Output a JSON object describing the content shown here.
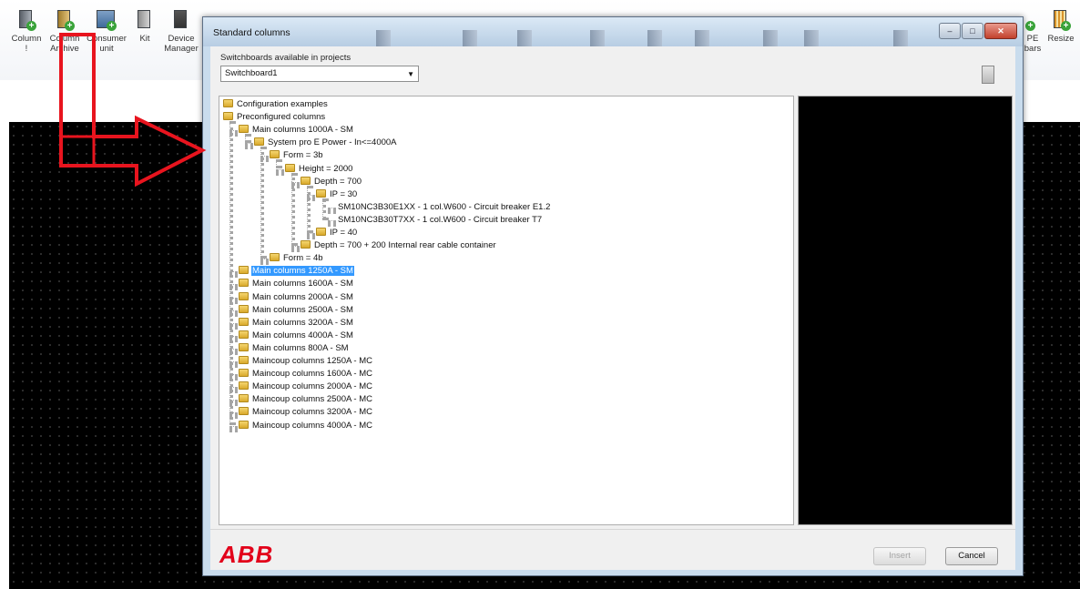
{
  "ribbon": {
    "buttons": [
      {
        "label": "Column\n!",
        "icon": "column-icon"
      },
      {
        "label": "Column\nArchive",
        "icon": "column-archive-icon"
      },
      {
        "label": "Consumer\nunit",
        "icon": "consumer-unit-icon"
      },
      {
        "label": "Kit",
        "icon": "kit-icon"
      },
      {
        "label": "Device\nManager",
        "icon": "device-manager-icon"
      }
    ],
    "right_buttons": [
      {
        "label": "PE\nbars",
        "icon": "pe-bars-icon"
      },
      {
        "label": "Resize",
        "icon": "resize-icon"
      }
    ]
  },
  "dialog": {
    "title": "Standard columns",
    "window_buttons": [
      "–",
      "□",
      "✕"
    ],
    "switchboards_label": "Switchboards available in projects",
    "switchboard_selected": "Switchboard1",
    "tree": [
      {
        "label": "Configuration examples",
        "level": 0
      },
      {
        "label": "Preconfigured columns",
        "level": 0
      },
      {
        "label": "Main columns 1000A - SM",
        "level": 1
      },
      {
        "label": "System pro E Power - In<=4000A",
        "level": 2
      },
      {
        "label": "Form = 3b",
        "level": 3
      },
      {
        "label": "Height = 2000",
        "level": 4
      },
      {
        "label": "Depth = 700",
        "level": 5
      },
      {
        "label": "IP = 30",
        "level": 6
      },
      {
        "label": "SM10NC3B30E1XX - 1 col.W600 - Circuit breaker E1.2",
        "level": 7,
        "leaf": true
      },
      {
        "label": "SM10NC3B30T7XX - 1 col.W600 - Circuit breaker T7",
        "level": 7,
        "leaf": true
      },
      {
        "label": "IP = 40",
        "level": 6
      },
      {
        "label": "Depth = 700 + 200 Internal rear cable container",
        "level": 5
      },
      {
        "label": "Form = 4b",
        "level": 3
      },
      {
        "label": "Main columns 1250A - SM",
        "level": 1,
        "selected": true
      },
      {
        "label": "Main columns 1600A - SM",
        "level": 1
      },
      {
        "label": "Main columns 2000A - SM",
        "level": 1
      },
      {
        "label": "Main columns 2500A - SM",
        "level": 1
      },
      {
        "label": "Main columns 3200A - SM",
        "level": 1
      },
      {
        "label": "Main columns 4000A - SM",
        "level": 1
      },
      {
        "label": "Main columns 800A - SM",
        "level": 1
      },
      {
        "label": "Maincoup columns 1250A - MC",
        "level": 1
      },
      {
        "label": "Maincoup columns 1600A - MC",
        "level": 1
      },
      {
        "label": "Maincoup columns 2000A - MC",
        "level": 1
      },
      {
        "label": "Maincoup columns 2500A - MC",
        "level": 1
      },
      {
        "label": "Maincoup columns 3200A - MC",
        "level": 1
      },
      {
        "label": "Maincoup columns 4000A - MC",
        "level": 1
      }
    ],
    "logo": "ABB",
    "insert_label": "Insert",
    "cancel_label": "Cancel"
  },
  "colors": {
    "annotation": "#e8141e",
    "selection": "#3399ff",
    "logo": "#e2001a"
  }
}
